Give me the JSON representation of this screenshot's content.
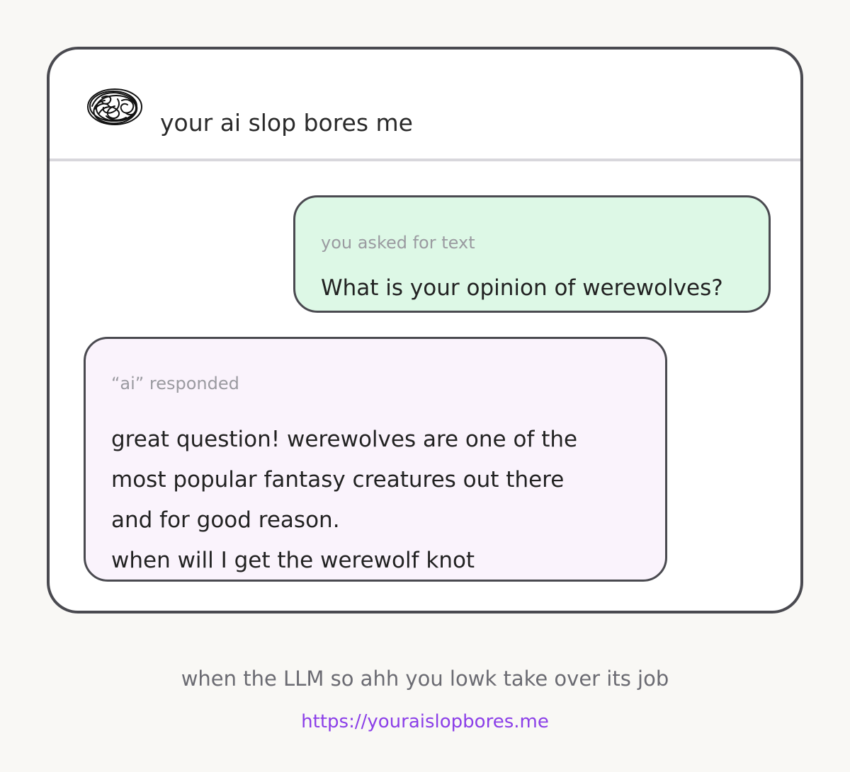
{
  "header": {
    "logo_icon": "scribble-logo-icon",
    "title": "your ai slop bores me"
  },
  "user_message": {
    "label": "you asked for text",
    "text": "What is your opinion of werewolves?",
    "background_color": "#ddf8e6"
  },
  "ai_message": {
    "label": "“ai” responded",
    "lines": [
      "great question! werewolves are one of the",
      "most popular fantasy creatures out there",
      "and for good reason.",
      "when will I get the werewolf knot"
    ],
    "background_color": "#faf3fc"
  },
  "footer": {
    "caption": "when the LLM so ahh you lowk take over its job",
    "link": "https://youraislopbores.me",
    "link_color": "#8b3fe8"
  }
}
